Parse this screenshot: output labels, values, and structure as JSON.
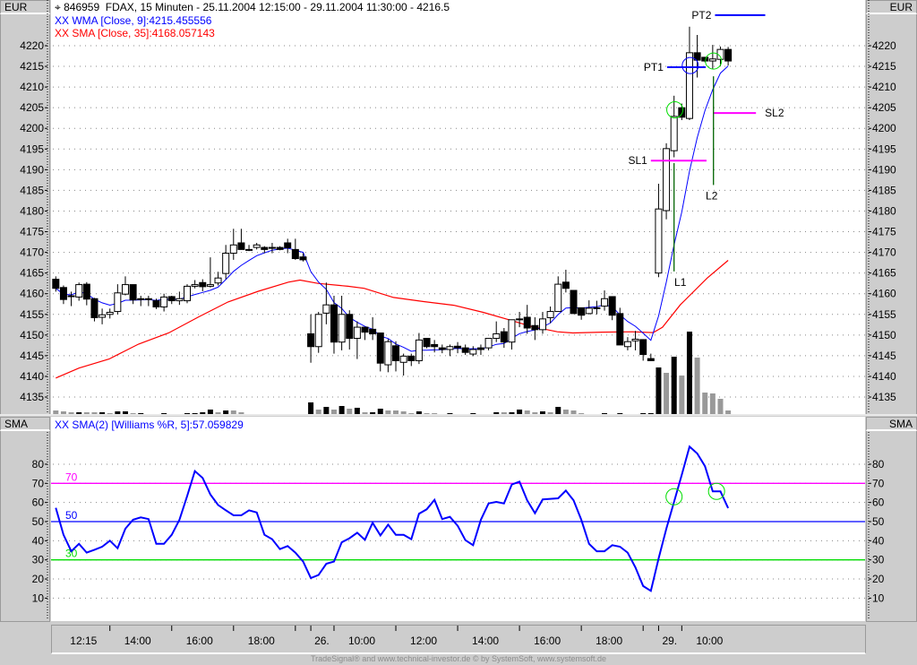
{
  "header": {
    "title": "846959  FDAX, 15 Minuten - 25.11.2004 12:15:00 - 29.11.2004 11:30:00 - 4216.5",
    "wma_label": "XX WMA [Close, 9]:4215.455556",
    "sma_label": "XX SMA [Close, 35]:4168.057143",
    "unit_left": "EUR",
    "unit_right": "EUR"
  },
  "indicator": {
    "label": "XX SMA(2) [Williams %R, 5]:57.059829",
    "unit_left": "SMA",
    "unit_right": "SMA",
    "levels": [
      {
        "value": 70,
        "label": "70",
        "color": "#ff00ff"
      },
      {
        "value": 50,
        "label": "50",
        "color": "#0000ff"
      },
      {
        "value": 30,
        "label": "30",
        "color": "#00dd00"
      }
    ]
  },
  "footer": "TradeSignal® and www.technical-investor.de © by  SystemSoft, www.systemsoft.de",
  "colors": {
    "wma": "#0000ff",
    "sma": "#ff0000",
    "indicator": "#0000ff",
    "signal_line": "#006400",
    "circle_green": "#00dd00",
    "circle_blue": "#0000ff",
    "pt": "#0000ff",
    "sl": "#ff00ff",
    "vol_dark": "#000000",
    "vol_light": "#999999"
  },
  "chart_data": [
    {
      "type": "candlestick",
      "title": "846959 FDAX, 15 Minuten",
      "ylim": [
        4130,
        4225
      ],
      "yticks": [
        4135,
        4140,
        4145,
        4150,
        4155,
        4160,
        4165,
        4170,
        4175,
        4180,
        4185,
        4190,
        4195,
        4200,
        4205,
        4210,
        4215,
        4220
      ],
      "xticks": [
        7,
        15,
        23,
        31,
        33,
        36,
        44,
        52,
        60,
        68,
        76,
        78,
        81
      ],
      "xlabels": [
        {
          "bar": 0,
          "text": "12:15"
        },
        {
          "bar": 7,
          "text": "14:00"
        },
        {
          "bar": 15,
          "text": "16:00"
        },
        {
          "bar": 23,
          "text": "18:00"
        },
        {
          "bar": 33,
          "text": "26."
        },
        {
          "bar": 36,
          "text": "10:00"
        },
        {
          "bar": 44,
          "text": "12:00"
        },
        {
          "bar": 52,
          "text": "14:00"
        },
        {
          "bar": 60,
          "text": "16:00"
        },
        {
          "bar": 68,
          "text": "18:00"
        },
        {
          "bar": 78,
          "text": "29."
        },
        {
          "bar": 81,
          "text": "10:00"
        }
      ],
      "ohlc": [
        [
          4163.5,
          4164.2,
          4160.5,
          4161.3
        ],
        [
          4161.5,
          4162,
          4157.5,
          4158.6
        ],
        [
          4159.5,
          4160.5,
          4157,
          4159.5
        ],
        [
          4159.2,
          4162.7,
          4158.3,
          4162.2
        ],
        [
          4162.3,
          4162.8,
          4157.2,
          4158.7
        ],
        [
          4158.8,
          4159,
          4153.3,
          4154.2
        ],
        [
          4154.3,
          4156.4,
          4152.6,
          4154.9
        ],
        [
          4155,
          4156.4,
          4154,
          4155.5
        ],
        [
          4155.7,
          4162.3,
          4155,
          4160.2
        ],
        [
          4159.9,
          4164.2,
          4159.6,
          4162.2
        ],
        [
          4162.2,
          4162.2,
          4157.5,
          4158.5
        ],
        [
          4158.8,
          4159.5,
          4157,
          4158.8
        ],
        [
          4158.8,
          4159.5,
          4157,
          4158.8
        ],
        [
          4158.3,
          4158.8,
          4156.3,
          4156.8
        ],
        [
          4156.8,
          4160,
          4155.7,
          4159.2
        ],
        [
          4159.3,
          4159.5,
          4157.5,
          4158.3
        ],
        [
          4158.3,
          4160.5,
          4157.3,
          4158.8
        ],
        [
          4158.3,
          4162.3,
          4157.7,
          4161.8
        ],
        [
          4161.8,
          4163.3,
          4161.3,
          4162.2
        ],
        [
          4162.7,
          4163.5,
          4160.6,
          4161.7
        ],
        [
          4161.8,
          4168.8,
          4161.5,
          4162.2
        ],
        [
          4162.6,
          4165.3,
          4162,
          4163.8
        ],
        [
          4164.9,
          4171.8,
          4163.5,
          4169.8
        ],
        [
          4169.8,
          4175.7,
          4168.2,
          4171.8
        ],
        [
          4172.3,
          4175.7,
          4170.7,
          4170.7
        ],
        [
          4170.7,
          4171.8,
          4170.3,
          4170.7
        ],
        [
          4171.2,
          4172.3,
          4170.7,
          4171.8
        ],
        [
          4171.2,
          4171.5,
          4169.8,
          4170.7
        ],
        [
          4171.2,
          4172.3,
          4169.8,
          4171.2
        ],
        [
          4171.2,
          4171.5,
          4170.5,
          4170.7
        ],
        [
          4172.3,
          4173.3,
          4169.8,
          4171.1
        ],
        [
          4170.7,
          4173.3,
          4168.2,
          4168.5
        ],
        [
          4168.9,
          4169.8,
          4167.8,
          4168.2
        ],
        [
          4150.3,
          4155,
          4143.3,
          4147.2
        ],
        [
          4147.2,
          4155.6,
          4145.7,
          4155
        ],
        [
          4155.3,
          4162.7,
          4152.6,
          4157.3
        ],
        [
          4157.3,
          4159.5,
          4145.5,
          4148.3
        ],
        [
          4148.3,
          4159.5,
          4146.3,
          4155
        ],
        [
          4155,
          4156,
          4146.5,
          4149.2
        ],
        [
          4149.2,
          4153.3,
          4144.2,
          4151.9
        ],
        [
          4151.9,
          4151.9,
          4148.8,
          4150.7
        ],
        [
          4151.4,
          4154.3,
          4148.8,
          4150.3
        ],
        [
          4150.5,
          4150.5,
          4141.2,
          4143.2
        ],
        [
          4142.8,
          4149,
          4141,
          4148.4
        ],
        [
          4147.4,
          4148.5,
          4141.2,
          4143.8
        ],
        [
          4143.4,
          4145.5,
          4140.2,
          4144.9
        ],
        [
          4144.9,
          4145.5,
          4142.5,
          4143.8
        ],
        [
          4143.8,
          4150.5,
          4143,
          4148.8
        ],
        [
          4149.2,
          4149.2,
          4146.8,
          4147.2
        ],
        [
          4147.7,
          4148.8,
          4145.8,
          4147.2
        ],
        [
          4146.9,
          4147.7,
          4145.6,
          4146.5
        ],
        [
          4146.5,
          4147.7,
          4144.9,
          4147.2
        ],
        [
          4147.3,
          4148.3,
          4145.6,
          4146.9
        ],
        [
          4146.9,
          4147.7,
          4145.2,
          4145.8
        ],
        [
          4145.4,
          4147.3,
          4144.9,
          4146.5
        ],
        [
          4146.9,
          4147.7,
          4145.2,
          4146.5
        ],
        [
          4146.9,
          4149.2,
          4146.3,
          4149.2
        ],
        [
          4149.2,
          4153.3,
          4148.3,
          4150.3
        ],
        [
          4150.8,
          4151.7,
          4146.9,
          4148.3
        ],
        [
          4148.3,
          4153.7,
          4146.5,
          4153.7
        ],
        [
          4153.7,
          4155.6,
          4151.9,
          4153.9
        ],
        [
          4154.3,
          4157.3,
          4150.3,
          4151.7
        ],
        [
          4152.3,
          4154.3,
          4148.8,
          4151.3
        ],
        [
          4151.3,
          4155.6,
          4150.3,
          4153.9
        ],
        [
          4154.2,
          4156.9,
          4152.9,
          4155.7
        ],
        [
          4155.7,
          4164.2,
          4155.6,
          4162.3
        ],
        [
          4162.8,
          4165.8,
          4160.3,
          4161.3
        ],
        [
          4160.8,
          4160.8,
          4155.2,
          4155.2
        ],
        [
          4156.6,
          4156.6,
          4153.7,
          4154.8
        ],
        [
          4155.2,
          4158.4,
          4155,
          4156.5
        ],
        [
          4156.6,
          4158.3,
          4155,
          4156.6
        ],
        [
          4157,
          4160.8,
          4155.9,
          4158.8
        ],
        [
          4159.3,
          4159.3,
          4153.6,
          4154.8
        ],
        [
          4155.2,
          4156.6,
          4147.6,
          4147.6
        ],
        [
          4147.2,
          4149.5,
          4146.3,
          4148.4
        ],
        [
          4148.6,
          4151,
          4146.3,
          4149
        ],
        [
          4148.9,
          4149,
          4143.8,
          4145.3
        ],
        [
          4144.3,
          4145.5,
          4143.8,
          4143.8
        ],
        [
          4165,
          4186.6,
          4164,
          4180.5
        ],
        [
          4180.1,
          4196.4,
          4178,
          4195.1
        ],
        [
          4194.6,
          4207.9,
          4193,
          4202.9
        ],
        [
          4205,
          4206,
          4202,
          4202.7
        ],
        [
          4202.4,
          4224.6,
          4202,
          4218.3
        ],
        [
          4218.3,
          4222.6,
          4212.3,
          4216.5
        ],
        [
          4217.2,
          4217.2,
          4216,
          4216.3
        ],
        [
          4216.3,
          4220.2,
          4214.4,
          4216.8
        ],
        [
          4216.7,
          4219.8,
          4215,
          4219.1
        ],
        [
          4219.1,
          4219.7,
          4215.2,
          4216.3
        ]
      ],
      "sma35_points": [
        [
          0,
          4139.6
        ],
        [
          3,
          4142
        ],
        [
          6.9,
          4144.2
        ],
        [
          10.7,
          4147.8
        ],
        [
          14.6,
          4150.5
        ],
        [
          18.5,
          4154.4
        ],
        [
          22.3,
          4158
        ],
        [
          26.2,
          4160.6
        ],
        [
          30.1,
          4162.8
        ],
        [
          31.6,
          4163.3
        ],
        [
          33.9,
          4162.5
        ],
        [
          37.8,
          4161.8
        ],
        [
          39.9,
          4161.3
        ],
        [
          43.7,
          4159.1
        ],
        [
          47.6,
          4158.1
        ],
        [
          51.5,
          4157.2
        ],
        [
          55.3,
          4155.5
        ],
        [
          59.2,
          4153.4
        ],
        [
          61.5,
          4152.1
        ],
        [
          64.9,
          4150.8
        ],
        [
          66.9,
          4150.5
        ],
        [
          70.7,
          4150.7
        ],
        [
          74.6,
          4150.8
        ],
        [
          77.3,
          4150.6
        ],
        [
          78.5,
          4151.9
        ],
        [
          80.8,
          4157.3
        ],
        [
          84.3,
          4163.8
        ],
        [
          87,
          4168.06
        ]
      ],
      "volume": [
        4,
        3,
        2,
        2,
        2,
        2,
        2,
        1,
        3,
        3,
        1,
        1,
        0,
        0,
        1,
        0,
        0,
        1,
        1,
        2,
        5,
        2,
        4,
        4,
        2,
        0,
        0,
        0,
        0,
        0,
        0,
        0,
        0,
        13,
        5,
        8,
        5,
        9,
        6,
        7,
        2,
        2,
        6,
        4,
        4,
        3,
        1,
        3,
        1,
        1,
        0,
        1,
        0,
        0,
        1,
        0,
        0,
        2,
        2,
        2,
        5,
        4,
        2,
        3,
        2,
        8,
        5,
        4,
        1,
        0,
        0,
        1,
        0,
        1,
        0,
        0,
        1,
        1,
        52,
        46,
        64,
        43,
        92,
        63,
        24,
        23,
        17,
        4
      ],
      "volume_dark": [
        0,
        0,
        0,
        1,
        0,
        0,
        1,
        0,
        1,
        1,
        0,
        1,
        0,
        0,
        1,
        0,
        0,
        1,
        1,
        1,
        1,
        0,
        1,
        0,
        0,
        0,
        0,
        0,
        0,
        0,
        0,
        0,
        0,
        1,
        0,
        1,
        0,
        1,
        0,
        1,
        0,
        1,
        1,
        0,
        0,
        0,
        0,
        1,
        0,
        0,
        0,
        1,
        0,
        0,
        1,
        0,
        0,
        1,
        0,
        1,
        1,
        0,
        0,
        1,
        0,
        1,
        0,
        0,
        0,
        0,
        0,
        1,
        0,
        1,
        0,
        0,
        1,
        1,
        1,
        0,
        1,
        0,
        1,
        0,
        0,
        0,
        0,
        0
      ],
      "annotations": {
        "lines": [
          {
            "label": "PT2",
            "kind": "pt",
            "from_bar": 85.3,
            "to_bar": 91.8,
            "price": 4227.4,
            "label_side": "left"
          },
          {
            "label": "PT1",
            "kind": "pt",
            "from_bar": 79.1,
            "to_bar": 84.1,
            "price": 4214.8,
            "label_side": "left"
          },
          {
            "label": "SL1",
            "kind": "sl",
            "from_bar": 77,
            "to_bar": 84.2,
            "price": 4192.2,
            "label_side": "left"
          },
          {
            "label": "SL2",
            "kind": "sl",
            "from_bar": 85.1,
            "to_bar": 90.6,
            "price": 4203.7,
            "label_side": "right"
          }
        ],
        "entries": [
          {
            "label": "L1",
            "bar": 80,
            "from_price": 4191.6,
            "to_price": 4165.4
          },
          {
            "label": "L2",
            "bar": 85.1,
            "from_price": 4212.6,
            "to_price": 4186.3
          }
        ],
        "circles": [
          {
            "bar": 80.1,
            "price": 4204.5,
            "color": "green"
          },
          {
            "bar": 82.1,
            "price": 4215.2,
            "color": "blue"
          },
          {
            "bar": 85.1,
            "price": 4216.3,
            "color": "green"
          }
        ]
      }
    },
    {
      "type": "line",
      "title": "SMA(2) [Williams %R, 5]",
      "ylim": [
        5,
        90
      ],
      "yticks": [
        10,
        20,
        30,
        40,
        50,
        60,
        70,
        80
      ],
      "values": [
        57.2,
        43.1,
        34.5,
        38.4,
        33.8,
        35.3,
        36.9,
        40.0,
        36.1,
        46.3,
        51.0,
        52.2,
        51.3,
        38.4,
        38.4,
        43.1,
        51.0,
        63.4,
        76.4,
        72.8,
        64.2,
        58.7,
        55.9,
        53.3,
        53.3,
        55.9,
        54.8,
        43.1,
        40.8,
        35.6,
        37.2,
        33.8,
        29.1,
        20.5,
        22.1,
        28.0,
        29.1,
        39.2,
        41.3,
        44.2,
        40.5,
        49.4,
        42.8,
        48.4,
        43.1,
        43.1,
        40.8,
        54.1,
        56.4,
        61.4,
        51.3,
        52.5,
        47.8,
        40.3,
        37.7,
        51.0,
        59.5,
        60.3,
        59.5,
        69.4,
        70.9,
        61.1,
        54.4,
        61.6,
        61.9,
        62.2,
        66.2,
        61.1,
        51.0,
        38.4,
        34.5,
        34.5,
        37.7,
        36.9,
        33.8,
        26.0,
        16.3,
        13.8,
        30.6,
        46.3,
        60.3,
        74.4,
        89.2,
        85.6,
        79.0,
        65.8,
        65.8,
        57.06
      ],
      "circles": [
        {
          "bar": 80,
          "value": 63
        },
        {
          "bar": 85.5,
          "value": 65.8
        }
      ]
    }
  ]
}
